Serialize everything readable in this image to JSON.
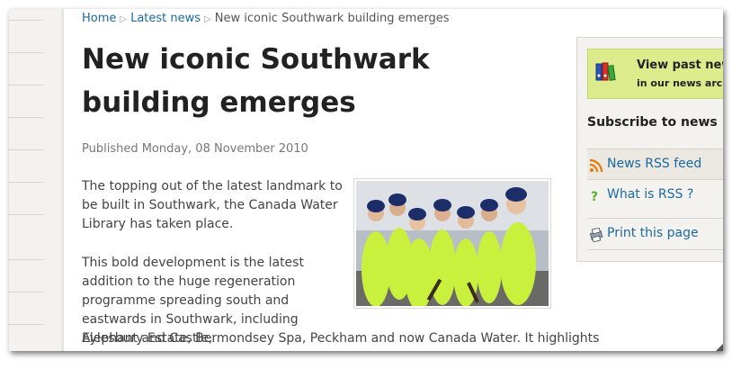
{
  "breadcrumb": {
    "home": "Home",
    "latest": "Latest news",
    "current": "New iconic Southwark building emerges",
    "separator": "▷"
  },
  "article": {
    "title": "New iconic Southwark building emerges",
    "published": "Published Monday, 08 November 2010",
    "paragraph1": "The topping out of the latest landmark to be built in Southwark, the Canada Water Library has taken place.",
    "paragraph2": "This bold development is the latest addition to the huge regeneration programme spreading south and eastwards in Southwark, including Elephant and Castle,",
    "paragraph2_cont": "Aylesbury Estate, Bermondsey Spa, Peckham and now Canada Water. It highlights"
  },
  "sidebar": {
    "archive_title": "View past news",
    "archive_sub": "in our news archive",
    "subscribe_heading": "Subscribe to news",
    "items": [
      {
        "label": "News RSS feed",
        "icon": "rss-icon"
      },
      {
        "label": "What is RSS ?",
        "icon": "question-icon"
      },
      {
        "label": "Print this page",
        "icon": "print-icon"
      }
    ]
  },
  "colors": {
    "link": "#1a6aa0",
    "archive_bg": "#dcec8c",
    "sidebar_bg": "#f4f2ee",
    "hi_vis": "#c8f03c"
  }
}
